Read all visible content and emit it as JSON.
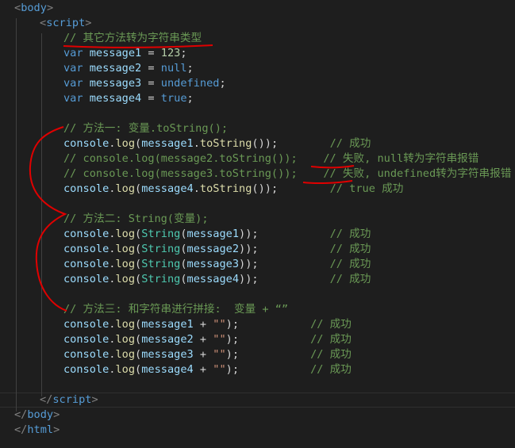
{
  "colors": {
    "background": "#1e1e1e",
    "tag": "#569cd6",
    "keyword": "#569cd6",
    "variable": "#9cdcfe",
    "number": "#b5cea8",
    "string": "#ce9178",
    "function": "#dcdcaa",
    "class": "#4ec9b0",
    "comment": "#6a9955",
    "annotation_ink": "#e00000"
  },
  "lines": [
    [
      [
        "t-br",
        "<"
      ],
      [
        "t-tag",
        "body"
      ],
      [
        "t-br",
        ">"
      ]
    ],
    [
      [
        "t-br",
        "<"
      ],
      [
        "t-tag",
        "script"
      ],
      [
        "t-br",
        ">"
      ]
    ],
    [
      [
        "t-cm",
        "// 其它方法转为字符串类型"
      ]
    ],
    [
      [
        "t-kw",
        "var"
      ],
      [
        "t-op",
        " "
      ],
      [
        "t-var",
        "message1"
      ],
      [
        "t-op",
        " = "
      ],
      [
        "t-num",
        "123"
      ],
      [
        "t-op",
        ";"
      ]
    ],
    [
      [
        "t-kw",
        "var"
      ],
      [
        "t-op",
        " "
      ],
      [
        "t-var",
        "message2"
      ],
      [
        "t-op",
        " = "
      ],
      [
        "t-kw",
        "null"
      ],
      [
        "t-op",
        ";"
      ]
    ],
    [
      [
        "t-kw",
        "var"
      ],
      [
        "t-op",
        " "
      ],
      [
        "t-var",
        "message3"
      ],
      [
        "t-op",
        " = "
      ],
      [
        "t-kw",
        "undefined"
      ],
      [
        "t-op",
        ";"
      ]
    ],
    [
      [
        "t-kw",
        "var"
      ],
      [
        "t-op",
        " "
      ],
      [
        "t-var",
        "message4"
      ],
      [
        "t-op",
        " = "
      ],
      [
        "t-kw",
        "true"
      ],
      [
        "t-op",
        ";"
      ]
    ],
    [],
    [
      [
        "t-cm",
        "// 方法一: 变量.toString();"
      ]
    ],
    [
      [
        "t-var",
        "console"
      ],
      [
        "t-op",
        "."
      ],
      [
        "t-fn",
        "log"
      ],
      [
        "t-op",
        "("
      ],
      [
        "t-var",
        "message1"
      ],
      [
        "t-op",
        "."
      ],
      [
        "t-fn",
        "toString"
      ],
      [
        "t-op",
        "());"
      ],
      [
        "t-op",
        "        "
      ],
      [
        "t-cm",
        "// 成功"
      ]
    ],
    [
      [
        "t-cm",
        "// console.log(message2.toString());    // 失败, null转为字符串报错"
      ]
    ],
    [
      [
        "t-cm",
        "// console.log(message3.toString());    // 失败, undefined转为字符串报错"
      ]
    ],
    [
      [
        "t-var",
        "console"
      ],
      [
        "t-op",
        "."
      ],
      [
        "t-fn",
        "log"
      ],
      [
        "t-op",
        "("
      ],
      [
        "t-var",
        "message4"
      ],
      [
        "t-op",
        "."
      ],
      [
        "t-fn",
        "toString"
      ],
      [
        "t-op",
        "());"
      ],
      [
        "t-op",
        "        "
      ],
      [
        "t-cm",
        "// true 成功"
      ]
    ],
    [],
    [
      [
        "t-cm",
        "// 方法二: String(变量);"
      ]
    ],
    [
      [
        "t-var",
        "console"
      ],
      [
        "t-op",
        "."
      ],
      [
        "t-fn",
        "log"
      ],
      [
        "t-op",
        "("
      ],
      [
        "t-cls",
        "String"
      ],
      [
        "t-op",
        "("
      ],
      [
        "t-var",
        "message1"
      ],
      [
        "t-op",
        "));"
      ],
      [
        "t-op",
        "           "
      ],
      [
        "t-cm",
        "// 成功"
      ]
    ],
    [
      [
        "t-var",
        "console"
      ],
      [
        "t-op",
        "."
      ],
      [
        "t-fn",
        "log"
      ],
      [
        "t-op",
        "("
      ],
      [
        "t-cls",
        "String"
      ],
      [
        "t-op",
        "("
      ],
      [
        "t-var",
        "message2"
      ],
      [
        "t-op",
        "));"
      ],
      [
        "t-op",
        "           "
      ],
      [
        "t-cm",
        "// 成功"
      ]
    ],
    [
      [
        "t-var",
        "console"
      ],
      [
        "t-op",
        "."
      ],
      [
        "t-fn",
        "log"
      ],
      [
        "t-op",
        "("
      ],
      [
        "t-cls",
        "String"
      ],
      [
        "t-op",
        "("
      ],
      [
        "t-var",
        "message3"
      ],
      [
        "t-op",
        "));"
      ],
      [
        "t-op",
        "           "
      ],
      [
        "t-cm",
        "// 成功"
      ]
    ],
    [
      [
        "t-var",
        "console"
      ],
      [
        "t-op",
        "."
      ],
      [
        "t-fn",
        "log"
      ],
      [
        "t-op",
        "("
      ],
      [
        "t-cls",
        "String"
      ],
      [
        "t-op",
        "("
      ],
      [
        "t-var",
        "message4"
      ],
      [
        "t-op",
        "));"
      ],
      [
        "t-op",
        "           "
      ],
      [
        "t-cm",
        "// 成功"
      ]
    ],
    [],
    [
      [
        "t-cm",
        "// 方法三: 和字符串进行拼接:  变量 + “”"
      ]
    ],
    [
      [
        "t-var",
        "console"
      ],
      [
        "t-op",
        "."
      ],
      [
        "t-fn",
        "log"
      ],
      [
        "t-op",
        "("
      ],
      [
        "t-var",
        "message1"
      ],
      [
        "t-op",
        " + "
      ],
      [
        "t-str",
        "\"\""
      ],
      [
        "t-op",
        ");"
      ],
      [
        "t-op",
        "           "
      ],
      [
        "t-cm",
        "// 成功"
      ]
    ],
    [
      [
        "t-var",
        "console"
      ],
      [
        "t-op",
        "."
      ],
      [
        "t-fn",
        "log"
      ],
      [
        "t-op",
        "("
      ],
      [
        "t-var",
        "message2"
      ],
      [
        "t-op",
        " + "
      ],
      [
        "t-str",
        "\"\""
      ],
      [
        "t-op",
        ");"
      ],
      [
        "t-op",
        "           "
      ],
      [
        "t-cm",
        "// 成功"
      ]
    ],
    [
      [
        "t-var",
        "console"
      ],
      [
        "t-op",
        "."
      ],
      [
        "t-fn",
        "log"
      ],
      [
        "t-op",
        "("
      ],
      [
        "t-var",
        "message3"
      ],
      [
        "t-op",
        " + "
      ],
      [
        "t-str",
        "\"\""
      ],
      [
        "t-op",
        ");"
      ],
      [
        "t-op",
        "           "
      ],
      [
        "t-cm",
        "// 成功"
      ]
    ],
    [
      [
        "t-var",
        "console"
      ],
      [
        "t-op",
        "."
      ],
      [
        "t-fn",
        "log"
      ],
      [
        "t-op",
        "("
      ],
      [
        "t-var",
        "message4"
      ],
      [
        "t-op",
        " + "
      ],
      [
        "t-str",
        "\"\""
      ],
      [
        "t-op",
        ");"
      ],
      [
        "t-op",
        "           "
      ],
      [
        "t-cm",
        "// 成功"
      ]
    ],
    [],
    [
      [
        "t-br",
        "</"
      ],
      [
        "t-tag",
        "script"
      ],
      [
        "t-br",
        ">"
      ]
    ],
    [
      [
        "t-br",
        "</"
      ],
      [
        "t-tag",
        "body"
      ],
      [
        "t-br",
        ">"
      ]
    ],
    [
      [
        "t-br",
        "</"
      ],
      [
        "t-tag",
        "html"
      ],
      [
        "t-br",
        ">"
      ]
    ]
  ]
}
